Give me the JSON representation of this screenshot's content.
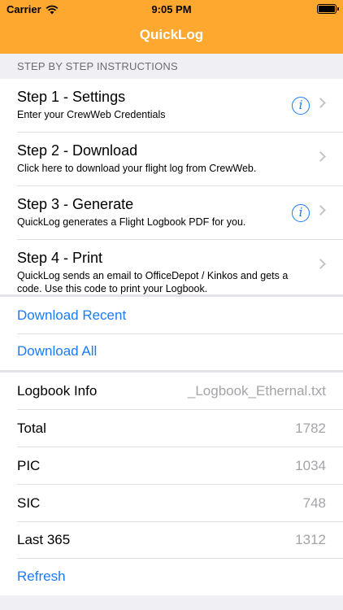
{
  "status_bar": {
    "carrier": "Carrier",
    "time": "9:05 PM"
  },
  "nav": {
    "title": "QuickLog",
    "background": "#fea82f"
  },
  "instructions": {
    "header": "STEP BY STEP INSTRUCTIONS",
    "steps": [
      {
        "title": "Step 1 - Settings",
        "subtitle": "Enter your CrewWeb Credentials",
        "info": true
      },
      {
        "title": "Step 2 - Download",
        "subtitle": "Click here to download your flight log from CrewWeb.",
        "info": false
      },
      {
        "title": "Step 3 - Generate",
        "subtitle": "QuickLog generates a Flight Logbook PDF for you.",
        "info": true
      },
      {
        "title": "Step 4 - Print",
        "subtitle": "QuickLog sends an email to OfficeDepot / Kinkos and gets a code. Use this code to print your Logbook.",
        "info": false
      }
    ]
  },
  "actions": {
    "download_recent": "Download Recent",
    "download_all": "Download All"
  },
  "logbook": {
    "info_label": "Logbook Info",
    "info_value": "_Logbook_Ethernal.txt",
    "total_label": "Total",
    "total_value": "1782",
    "pic_label": "PIC",
    "pic_value": "1034",
    "sic_label": "SIC",
    "sic_value": "748",
    "last365_label": "Last 365",
    "last365_value": "1312",
    "refresh": "Refresh"
  },
  "colors": {
    "accent": "#1a7cf6",
    "secondary_text": "#a4a4a8"
  }
}
